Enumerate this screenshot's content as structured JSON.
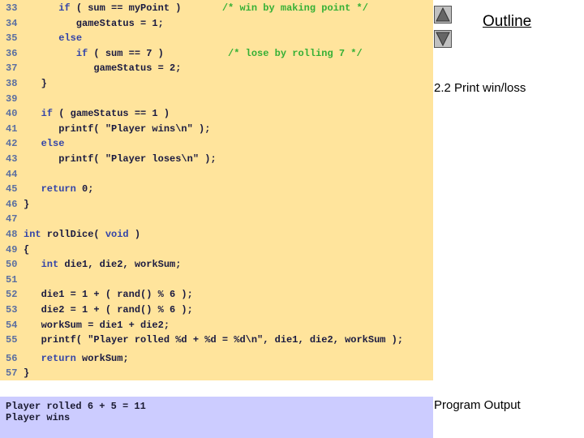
{
  "sidebar": {
    "outline_title": "Outline",
    "section_label": "2.2  Print win/loss",
    "program_output_label": "Program Output",
    "prev_icon": "triangle-up-icon",
    "next_icon": "triangle-down-icon"
  },
  "code": {
    "lines": [
      {
        "num": "33",
        "segs": [
          [
            "tx",
            "      "
          ],
          [
            "kw",
            "if"
          ],
          [
            "tx",
            " ( sum == myPoint )       "
          ],
          [
            "cm",
            "/* win by making point */"
          ]
        ]
      },
      {
        "num": "34",
        "segs": [
          [
            "tx",
            "         gameStatus = 1;"
          ]
        ]
      },
      {
        "num": "35",
        "segs": [
          [
            "tx",
            "      "
          ],
          [
            "kw",
            "else"
          ]
        ]
      },
      {
        "num": "36",
        "segs": [
          [
            "tx",
            "         "
          ],
          [
            "kw",
            "if"
          ],
          [
            "tx",
            " ( sum == 7 )           "
          ],
          [
            "cm",
            "/* lose by rolling 7 */"
          ]
        ]
      },
      {
        "num": "37",
        "segs": [
          [
            "tx",
            "            gameStatus = 2;"
          ]
        ]
      },
      {
        "num": "38",
        "segs": [
          [
            "tx",
            "   }"
          ]
        ]
      },
      {
        "num": "39",
        "segs": []
      },
      {
        "num": "40",
        "segs": [
          [
            "tx",
            "   "
          ],
          [
            "kw",
            "if"
          ],
          [
            "tx",
            " ( gameStatus == 1 )"
          ]
        ]
      },
      {
        "num": "41",
        "segs": [
          [
            "tx",
            "      printf( \"Player wins\\n\" );"
          ]
        ]
      },
      {
        "num": "42",
        "segs": [
          [
            "tx",
            "   "
          ],
          [
            "kw",
            "else"
          ]
        ]
      },
      {
        "num": "43",
        "segs": [
          [
            "tx",
            "      printf( \"Player loses\\n\" );"
          ]
        ]
      },
      {
        "num": "44",
        "segs": []
      },
      {
        "num": "45",
        "segs": [
          [
            "tx",
            "   "
          ],
          [
            "kw",
            "return"
          ],
          [
            "tx",
            " 0;"
          ]
        ]
      },
      {
        "num": "46",
        "segs": [
          [
            "tx",
            "}"
          ]
        ]
      },
      {
        "num": "47",
        "segs": []
      },
      {
        "num": "48",
        "segs": [
          [
            "kw",
            "int"
          ],
          [
            "tx",
            " rollDice( "
          ],
          [
            "kw",
            "void"
          ],
          [
            "tx",
            " )"
          ]
        ]
      },
      {
        "num": "49",
        "segs": [
          [
            "tx",
            "{"
          ]
        ]
      },
      {
        "num": "50",
        "segs": [
          [
            "tx",
            "   "
          ],
          [
            "kw",
            "int"
          ],
          [
            "tx",
            " die1, die2, workSum;"
          ]
        ]
      },
      {
        "num": "51",
        "segs": []
      },
      {
        "num": "52",
        "segs": [
          [
            "tx",
            "   die1 = 1 + ( rand() % 6 );"
          ]
        ]
      },
      {
        "num": "53",
        "segs": [
          [
            "tx",
            "   die2 = 1 + ( rand() % 6 );"
          ]
        ]
      },
      {
        "num": "54",
        "segs": [
          [
            "tx",
            "   workSum = die1 + die2;"
          ]
        ]
      },
      {
        "num": "55",
        "segs": [
          [
            "tx",
            "   printf( \"Player rolled %d + %d = %d\\n\", die1, die2, workSum );"
          ]
        ]
      },
      {
        "num": "56",
        "segs": [
          [
            "tx",
            "   "
          ],
          [
            "kw",
            "return"
          ],
          [
            "tx",
            " workSum;"
          ]
        ]
      },
      {
        "num": "57",
        "segs": [
          [
            "tx",
            "}"
          ]
        ]
      }
    ]
  },
  "output": {
    "lines": [
      "Player rolled 6 + 5 = 11",
      "Player wins"
    ]
  },
  "colors": {
    "code_bg": "#ffe49c",
    "output_bg": "#ccccff",
    "keyword": "#3344a8",
    "comment": "#35b035"
  }
}
